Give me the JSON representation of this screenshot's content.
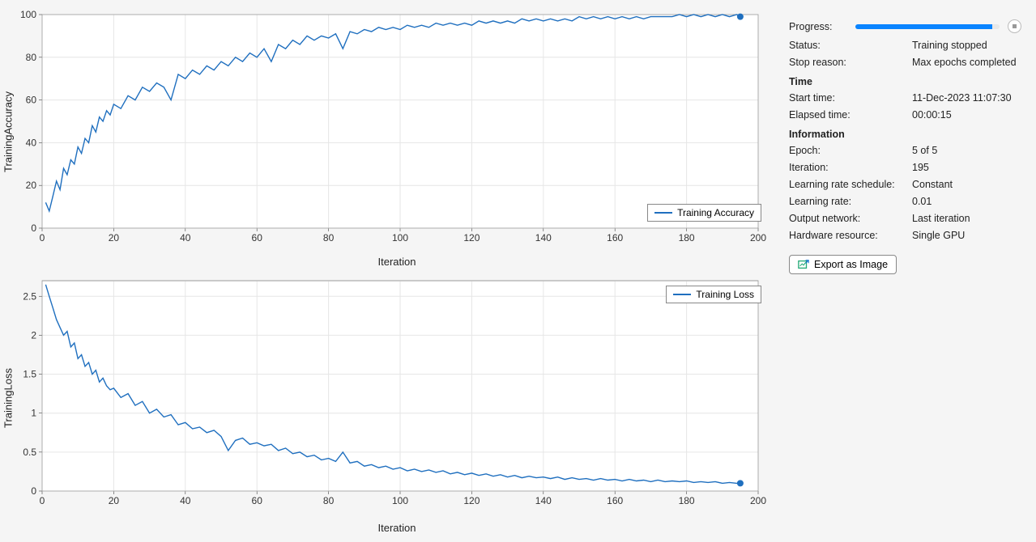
{
  "chart_data": [
    {
      "type": "line",
      "title": "",
      "xlabel": "Iteration",
      "ylabel": "TrainingAccuracy",
      "xlim": [
        0,
        200
      ],
      "ylim": [
        0,
        100
      ],
      "xticks": [
        0,
        20,
        40,
        60,
        80,
        100,
        120,
        140,
        160,
        180,
        200
      ],
      "yticks": [
        0,
        20,
        40,
        60,
        80,
        100
      ],
      "legend": "Training Accuracy",
      "x": [
        1,
        2,
        3,
        4,
        5,
        6,
        7,
        8,
        9,
        10,
        11,
        12,
        13,
        14,
        15,
        16,
        17,
        18,
        19,
        20,
        22,
        24,
        26,
        28,
        30,
        32,
        34,
        36,
        38,
        40,
        42,
        44,
        46,
        48,
        50,
        52,
        54,
        56,
        58,
        60,
        62,
        64,
        66,
        68,
        70,
        72,
        74,
        76,
        78,
        80,
        82,
        84,
        86,
        88,
        90,
        92,
        94,
        96,
        98,
        100,
        102,
        104,
        106,
        108,
        110,
        112,
        114,
        116,
        118,
        120,
        122,
        124,
        126,
        128,
        130,
        132,
        134,
        136,
        138,
        140,
        142,
        144,
        146,
        148,
        150,
        152,
        154,
        156,
        158,
        160,
        162,
        164,
        166,
        168,
        170,
        172,
        174,
        176,
        178,
        180,
        182,
        184,
        186,
        188,
        190,
        192,
        194,
        195
      ],
      "values": [
        12,
        8,
        15,
        22,
        18,
        28,
        25,
        32,
        30,
        38,
        35,
        42,
        40,
        48,
        45,
        52,
        50,
        55,
        53,
        58,
        56,
        62,
        60,
        66,
        64,
        68,
        66,
        60,
        72,
        70,
        74,
        72,
        76,
        74,
        78,
        76,
        80,
        78,
        82,
        80,
        84,
        78,
        86,
        84,
        88,
        86,
        90,
        88,
        90,
        89,
        91,
        84,
        92,
        91,
        93,
        92,
        94,
        93,
        94,
        93,
        95,
        94,
        95,
        94,
        96,
        95,
        96,
        95,
        96,
        95,
        97,
        96,
        97,
        96,
        97,
        96,
        98,
        97,
        98,
        97,
        98,
        97,
        98,
        97,
        99,
        98,
        99,
        98,
        99,
        98,
        99,
        98,
        99,
        98,
        99,
        99,
        99,
        99,
        100,
        99,
        100,
        99,
        100,
        99,
        100,
        99,
        100,
        99
      ],
      "end_marker": {
        "x": 195,
        "y": 99
      }
    },
    {
      "type": "line",
      "title": "",
      "xlabel": "Iteration",
      "ylabel": "TrainingLoss",
      "xlim": [
        0,
        200
      ],
      "ylim": [
        0,
        2.7
      ],
      "xticks": [
        0,
        20,
        40,
        60,
        80,
        100,
        120,
        140,
        160,
        180,
        200
      ],
      "yticks": [
        0,
        0.5,
        1,
        1.5,
        2,
        2.5
      ],
      "legend": "Training Loss",
      "x": [
        1,
        2,
        3,
        4,
        5,
        6,
        7,
        8,
        9,
        10,
        11,
        12,
        13,
        14,
        15,
        16,
        17,
        18,
        19,
        20,
        22,
        24,
        26,
        28,
        30,
        32,
        34,
        36,
        38,
        40,
        42,
        44,
        46,
        48,
        50,
        52,
        54,
        56,
        58,
        60,
        62,
        64,
        66,
        68,
        70,
        72,
        74,
        76,
        78,
        80,
        82,
        84,
        86,
        88,
        90,
        92,
        94,
        96,
        98,
        100,
        102,
        104,
        106,
        108,
        110,
        112,
        114,
        116,
        118,
        120,
        122,
        124,
        126,
        128,
        130,
        132,
        134,
        136,
        138,
        140,
        142,
        144,
        146,
        148,
        150,
        152,
        154,
        156,
        158,
        160,
        162,
        164,
        166,
        168,
        170,
        172,
        174,
        176,
        178,
        180,
        182,
        184,
        186,
        188,
        190,
        192,
        194,
        195
      ],
      "values": [
        2.65,
        2.5,
        2.35,
        2.2,
        2.1,
        2.0,
        2.05,
        1.85,
        1.9,
        1.7,
        1.75,
        1.6,
        1.65,
        1.5,
        1.55,
        1.4,
        1.45,
        1.35,
        1.3,
        1.32,
        1.2,
        1.25,
        1.1,
        1.15,
        1.0,
        1.05,
        0.95,
        0.98,
        0.85,
        0.88,
        0.8,
        0.82,
        0.75,
        0.78,
        0.7,
        0.52,
        0.65,
        0.68,
        0.6,
        0.62,
        0.58,
        0.6,
        0.52,
        0.55,
        0.48,
        0.5,
        0.44,
        0.46,
        0.4,
        0.42,
        0.38,
        0.5,
        0.36,
        0.38,
        0.32,
        0.34,
        0.3,
        0.32,
        0.28,
        0.3,
        0.26,
        0.28,
        0.25,
        0.27,
        0.24,
        0.26,
        0.22,
        0.24,
        0.21,
        0.23,
        0.2,
        0.22,
        0.19,
        0.21,
        0.18,
        0.2,
        0.17,
        0.19,
        0.17,
        0.18,
        0.16,
        0.18,
        0.15,
        0.17,
        0.15,
        0.16,
        0.14,
        0.16,
        0.14,
        0.15,
        0.13,
        0.15,
        0.13,
        0.14,
        0.12,
        0.14,
        0.12,
        0.13,
        0.12,
        0.13,
        0.11,
        0.12,
        0.11,
        0.12,
        0.1,
        0.11,
        0.1,
        0.1
      ],
      "end_marker": {
        "x": 195,
        "y": 0.1
      }
    }
  ],
  "panel": {
    "progress_label": "Progress:",
    "progress_pct": 95,
    "status_label": "Status:",
    "status_value": "Training stopped",
    "stop_reason_label": "Stop reason:",
    "stop_reason_value": "Max epochs completed",
    "time_title": "Time",
    "start_time_label": "Start time:",
    "start_time_value": "11-Dec-2023 11:07:30",
    "elapsed_label": "Elapsed time:",
    "elapsed_value": "00:00:15",
    "info_title": "Information",
    "epoch_label": "Epoch:",
    "epoch_value": "5 of 5",
    "iteration_label": "Iteration:",
    "iteration_value": "195",
    "lr_sched_label": "Learning rate schedule:",
    "lr_sched_value": "Constant",
    "lr_label": "Learning rate:",
    "lr_value": "0.01",
    "output_net_label": "Output network:",
    "output_net_value": "Last iteration",
    "hw_label": "Hardware resource:",
    "hw_value": "Single GPU",
    "export_label": "Export as Image"
  }
}
